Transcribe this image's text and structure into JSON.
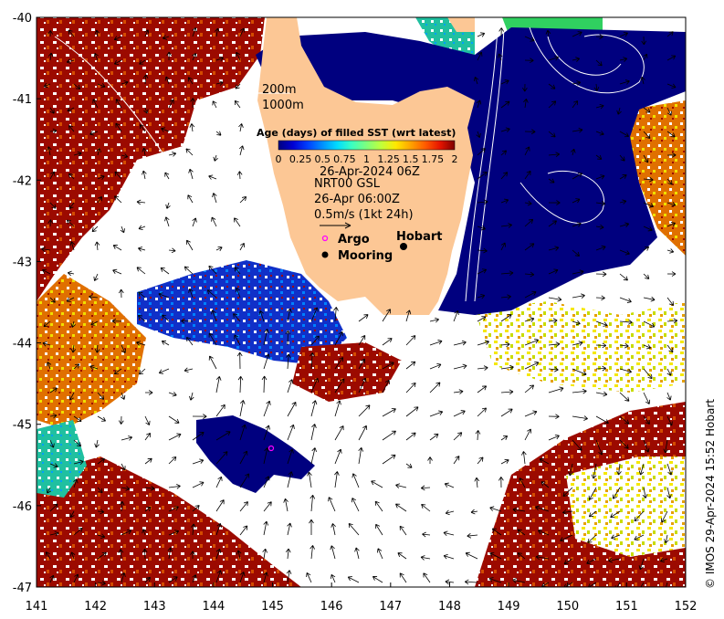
{
  "map": {
    "x_ticks": [
      "141",
      "142",
      "143",
      "144",
      "145",
      "146",
      "147",
      "148",
      "149",
      "150",
      "151",
      "152"
    ],
    "y_ticks": [
      "-40",
      "-41",
      "-42",
      "-43",
      "-44",
      "-45",
      "-46",
      "-47"
    ],
    "x_range": [
      141,
      152
    ],
    "y_range": [
      -47,
      -40
    ],
    "colors": {
      "land": "#fcc795",
      "no_data": "#ffffff",
      "current_sst": "#00007f",
      "old_sst": "#9c0a00",
      "contour": "#ffffff",
      "vector": "#000000",
      "argo": "#ff00ff",
      "mooring": "#000000"
    }
  },
  "bathymetry": {
    "contour_200": "200m",
    "contour_1000": "1000m"
  },
  "colorbar": {
    "title": "Age (days) of filled SST (wrt latest)",
    "tick_labels": [
      "0",
      "0.25",
      "0.5",
      "0.75",
      "1",
      "1.25",
      "1.5",
      "1.75",
      "2"
    ],
    "palette": [
      "#00007f",
      "#0000d4",
      "#0040ff",
      "#0090ff",
      "#00dcff",
      "#3bffc1",
      "#7eff7d",
      "#c1ff3b",
      "#ffe800",
      "#ffa400",
      "#ff5b00",
      "#e61400",
      "#7f0000"
    ]
  },
  "annotations": {
    "sst_time": "26-Apr-2024 06Z",
    "current_source": "NRT00 GSL",
    "current_time": "26-Apr 06:00Z",
    "current_scale": "0.5m/s (1kt 24h)"
  },
  "symbols": {
    "argo_label": "Argo",
    "mooring_label": "Mooring"
  },
  "places": {
    "hobart": "Hobart"
  },
  "credit": "© IMOS 29-Apr-2024 15:52 Hobart"
}
